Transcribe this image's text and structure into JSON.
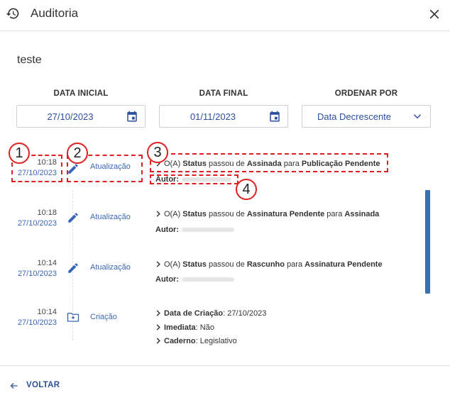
{
  "header": {
    "title": "Auditoria",
    "history_icon": "history-icon",
    "close_icon": "close-icon"
  },
  "subtitle": "teste",
  "filters": {
    "start": {
      "label": "DATA INICIAL",
      "value": "27/10/2023",
      "icon": "calendar-icon"
    },
    "end": {
      "label": "DATA FINAL",
      "value": "01/11/2023",
      "icon": "calendar-icon"
    },
    "order": {
      "label": "ORDENAR POR",
      "value": "Data Decrescente",
      "icon": "chevron-down-icon"
    }
  },
  "entries": [
    {
      "time": "10:18",
      "date": "27/10/2023",
      "type": "Atualização",
      "icon": "pencil-icon",
      "prefix": "O(A)",
      "field": "Status",
      "w1": "passou de",
      "from": "Assinada",
      "w2": "para",
      "to": "Publicação Pendente",
      "author_label": "Autor:"
    },
    {
      "time": "10:18",
      "date": "27/10/2023",
      "type": "Atualização",
      "icon": "pencil-icon",
      "prefix": "O(A)",
      "field": "Status",
      "w1": "passou de",
      "from": "Assinatura Pendente",
      "w2": "para",
      "to": "Assinada",
      "author_label": "Autor:"
    },
    {
      "time": "10:14",
      "date": "27/10/2023",
      "type": "Atualização",
      "icon": "pencil-icon",
      "prefix": "O(A)",
      "field": "Status",
      "w1": "passou de",
      "from": "Rascunho",
      "w2": "para",
      "to": "Assinatura Pendente",
      "author_label": "Autor:"
    },
    {
      "time": "10:14",
      "date": "27/10/2023",
      "type": "Criação",
      "icon": "folder-add-icon",
      "lines": [
        {
          "key": "Data de Criação",
          "value": "27/10/2023"
        },
        {
          "key": "Imediata",
          "value": "Não"
        },
        {
          "key": "Caderno",
          "value": "Legislativo"
        }
      ]
    }
  ],
  "annotations": [
    "1",
    "2",
    "3",
    "4"
  ],
  "footer": {
    "back_label": "VOLTAR",
    "back_icon": "arrow-left-icon"
  },
  "colors": {
    "accent": "#3a66b8",
    "annotation": "#e02020",
    "scrollbar": "#3a6fb0"
  }
}
